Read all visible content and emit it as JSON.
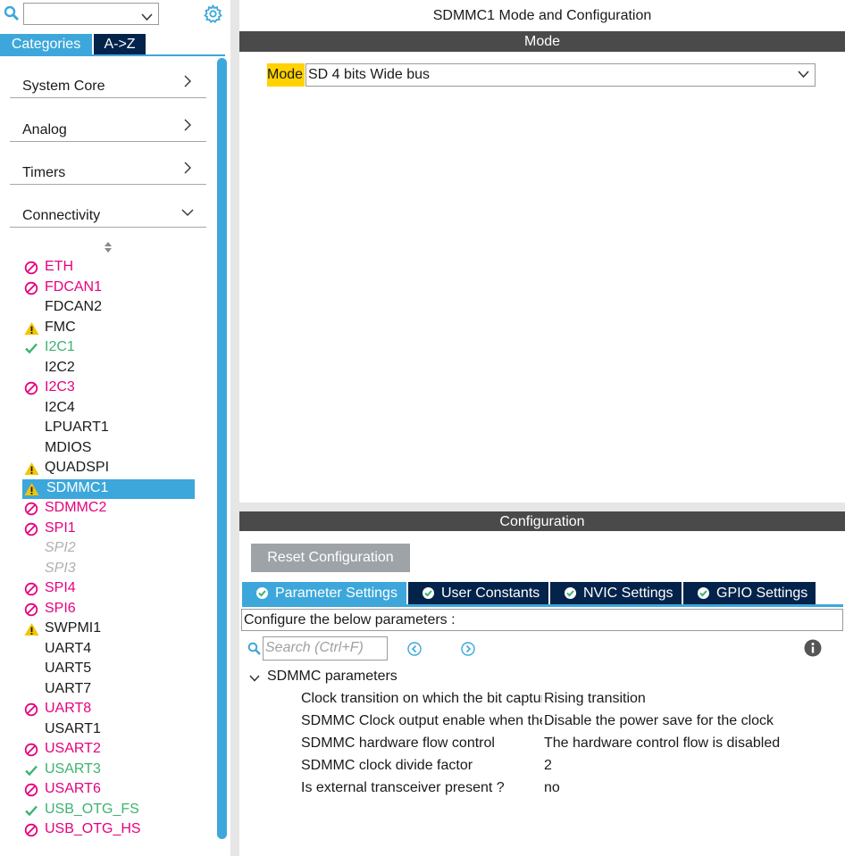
{
  "left_panel": {
    "search": {
      "value": ""
    },
    "tabs": {
      "categories": "Categories",
      "az": "A->Z"
    },
    "categories": [
      {
        "label": "System Core",
        "expanded": false
      },
      {
        "label": "Analog",
        "expanded": false
      },
      {
        "label": "Timers",
        "expanded": false
      },
      {
        "label": "Connectivity",
        "expanded": true
      }
    ],
    "peripherals": [
      {
        "label": "ETH",
        "status": "disabled"
      },
      {
        "label": "FDCAN1",
        "status": "disabled"
      },
      {
        "label": "FDCAN2",
        "status": "none"
      },
      {
        "label": "FMC",
        "status": "warning"
      },
      {
        "label": "I2C1",
        "status": "ok"
      },
      {
        "label": "I2C2",
        "status": "none"
      },
      {
        "label": "I2C3",
        "status": "disabled"
      },
      {
        "label": "I2C4",
        "status": "none"
      },
      {
        "label": "LPUART1",
        "status": "none"
      },
      {
        "label": "MDIOS",
        "status": "none"
      },
      {
        "label": "QUADSPI",
        "status": "warning"
      },
      {
        "label": "SDMMC1",
        "status": "warning",
        "selected": true
      },
      {
        "label": "SDMMC2",
        "status": "disabled"
      },
      {
        "label": "SPI1",
        "status": "disabled"
      },
      {
        "label": "SPI2",
        "status": "unavailable"
      },
      {
        "label": "SPI3",
        "status": "unavailable"
      },
      {
        "label": "SPI4",
        "status": "disabled"
      },
      {
        "label": "SPI6",
        "status": "disabled"
      },
      {
        "label": "SWPMI1",
        "status": "warning"
      },
      {
        "label": "UART4",
        "status": "none"
      },
      {
        "label": "UART5",
        "status": "none"
      },
      {
        "label": "UART7",
        "status": "none"
      },
      {
        "label": "UART8",
        "status": "disabled"
      },
      {
        "label": "USART1",
        "status": "none"
      },
      {
        "label": "USART2",
        "status": "disabled"
      },
      {
        "label": "USART3",
        "status": "ok"
      },
      {
        "label": "USART6",
        "status": "disabled"
      },
      {
        "label": "USB_OTG_FS",
        "status": "ok"
      },
      {
        "label": "USB_OTG_HS",
        "status": "disabled"
      }
    ]
  },
  "main": {
    "title": "SDMMC1 Mode and Configuration",
    "mode_header": "Mode",
    "mode_label": "Mode",
    "mode_value": "SD 4 bits Wide bus",
    "config_header": "Configuration",
    "reset_button": "Reset Configuration",
    "config_tabs": [
      {
        "label": "Parameter Settings",
        "active": true
      },
      {
        "label": "User Constants",
        "active": false
      },
      {
        "label": "NVIC Settings",
        "active": false
      },
      {
        "label": "GPIO Settings",
        "active": false
      }
    ],
    "configure_text": "Configure the below parameters :",
    "search_placeholder": "Search (Ctrl+F)",
    "group_label": "SDMMC parameters",
    "params": [
      {
        "name": "Clock transition on which the bit captur.",
        "value": "Rising transition"
      },
      {
        "name": "SDMMC Clock output enable when the.",
        "value": "Disable the power save for the clock"
      },
      {
        "name": "SDMMC hardware flow control",
        "value": "The hardware control flow is disabled"
      },
      {
        "name": "SDMMC clock divide factor",
        "value": "2"
      },
      {
        "name": "Is external transceiver present ?",
        "value": "no"
      }
    ]
  },
  "colors": {
    "accent": "#3da7db",
    "navy": "#03234b",
    "header_gray": "#4a4a4a",
    "mode_highlight": "#ffd200",
    "disabled_red": "#e6007e",
    "ok_green": "#3cb371",
    "warning_yellow": "#f5c400"
  }
}
